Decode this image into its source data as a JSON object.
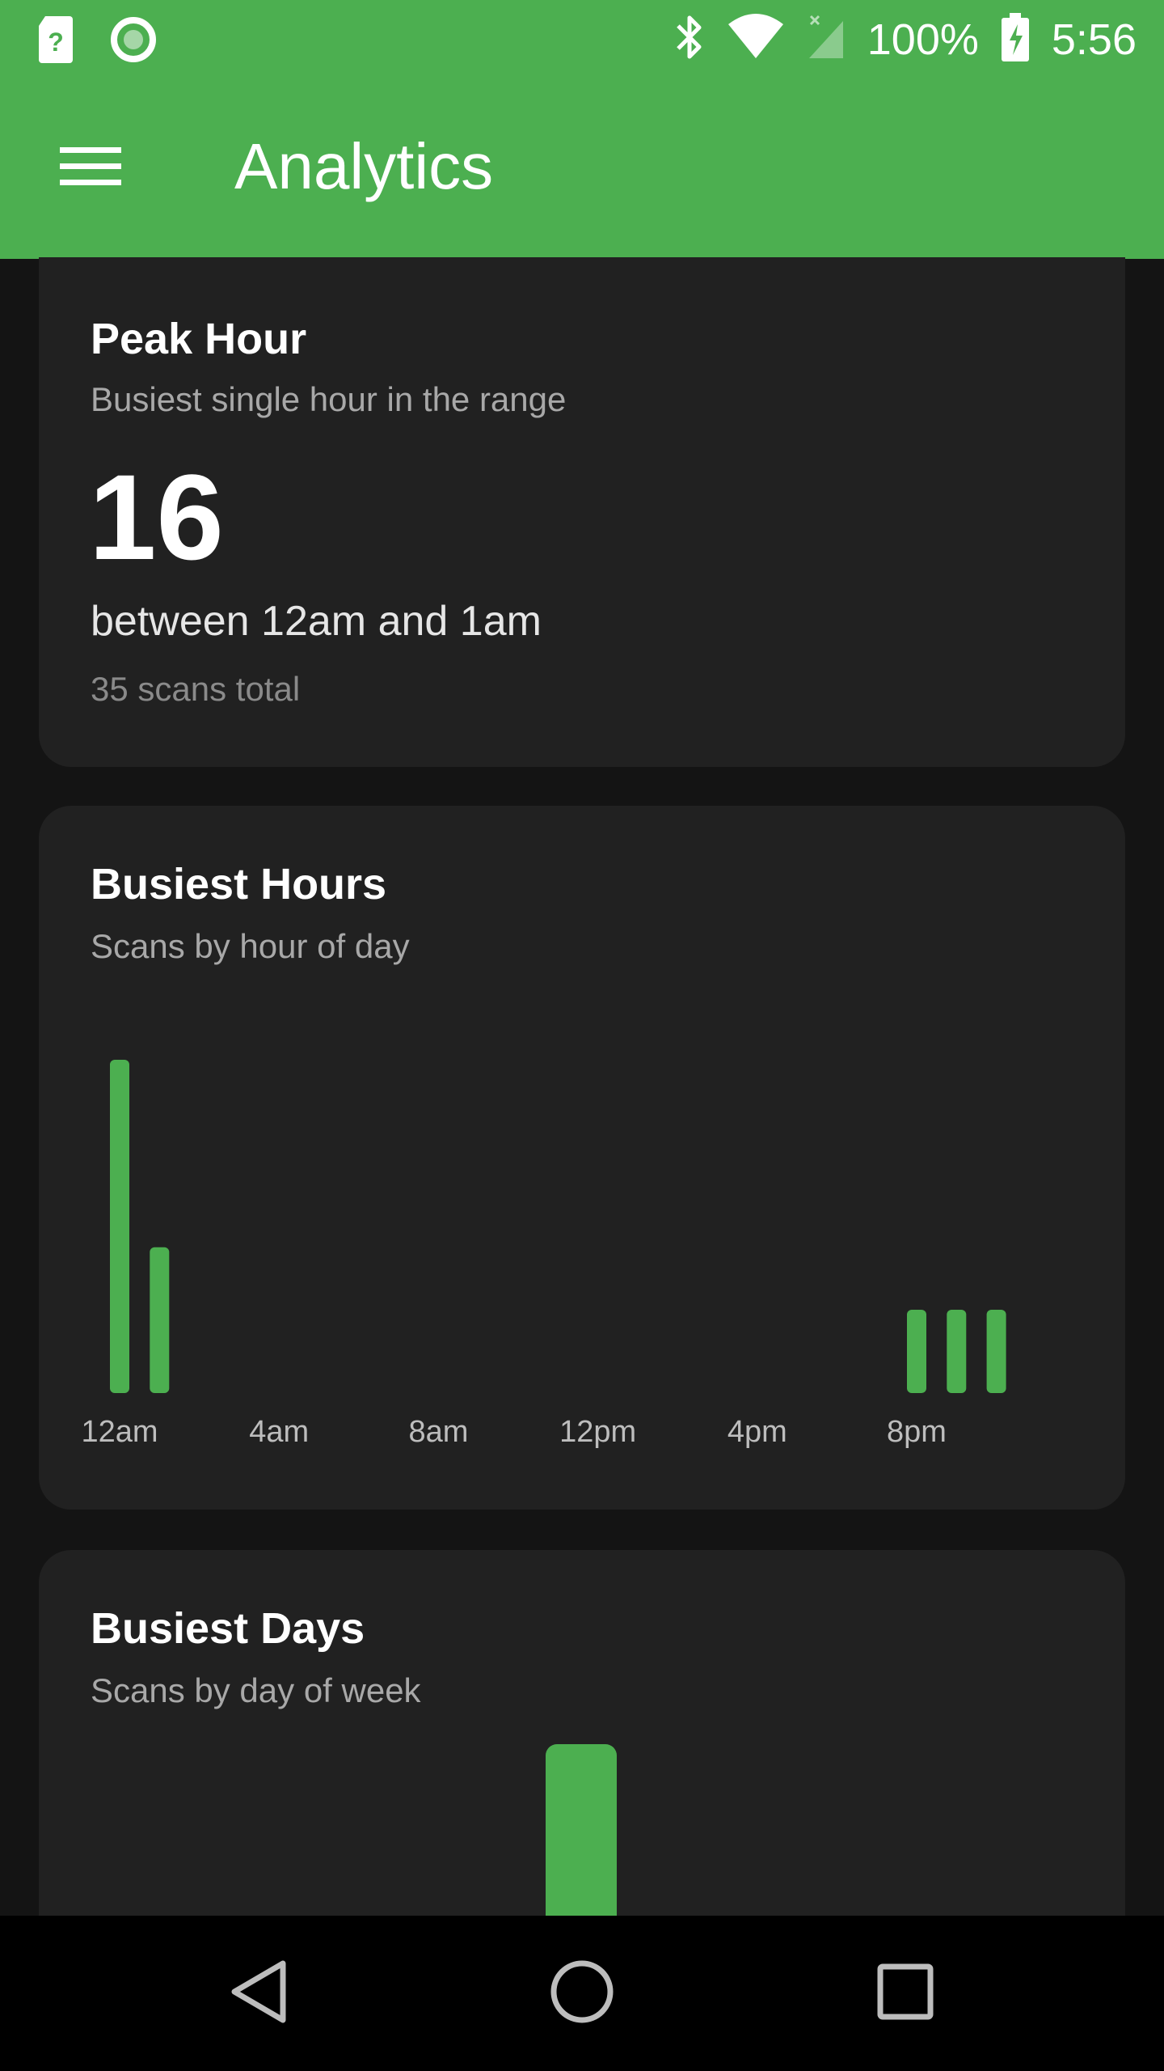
{
  "status_bar": {
    "battery_percent": "100%",
    "time": "5:56",
    "icons": [
      "sim-unknown-icon",
      "record-icon",
      "bluetooth-icon",
      "wifi-icon",
      "cell-signal-icon",
      "battery-charging-icon"
    ]
  },
  "app_bar": {
    "title": "Analytics",
    "menu_icon": "hamburger-menu-icon"
  },
  "peak_hour_card": {
    "title": "Peak Hour",
    "subtitle": "Busiest single hour in the range",
    "value": "16",
    "range_text": "between 12am and 1am",
    "total_text": "35 scans total"
  },
  "busiest_hours_card": {
    "title": "Busiest Hours",
    "subtitle": "Scans by hour of day"
  },
  "busiest_days_card": {
    "title": "Busiest Days",
    "subtitle": "Scans by day of week"
  },
  "colors": {
    "accent": "#4caf50",
    "background": "#141414",
    "card": "#212121"
  },
  "chart_data": [
    {
      "type": "bar",
      "title": "Busiest Hours",
      "subtitle": "Scans by hour of day",
      "categories": [
        "12am",
        "1am",
        "2am",
        "3am",
        "4am",
        "5am",
        "6am",
        "7am",
        "8am",
        "9am",
        "10am",
        "11am",
        "12pm",
        "1pm",
        "2pm",
        "3pm",
        "4pm",
        "5pm",
        "6pm",
        "7pm",
        "8pm",
        "9pm",
        "10pm",
        "11pm"
      ],
      "values": [
        16,
        7,
        0,
        0,
        0,
        0,
        0,
        0,
        0,
        0,
        0,
        0,
        0,
        0,
        0,
        0,
        0,
        0,
        0,
        0,
        4,
        4,
        4,
        0
      ],
      "tick_labels": [
        "12am",
        "4am",
        "8am",
        "12pm",
        "4pm",
        "8pm"
      ],
      "tick_indices": [
        0,
        4,
        8,
        12,
        16,
        20
      ],
      "ylim": [
        0,
        16
      ]
    },
    {
      "type": "bar",
      "title": "Busiest Days",
      "subtitle": "Scans by day of week",
      "categories": [
        "",
        "",
        "",
        "",
        "",
        "",
        ""
      ],
      "values": [
        0,
        0,
        0,
        1,
        0,
        0,
        0
      ],
      "partially_visible": true
    }
  ],
  "navigation": {
    "back_icon": "back-triangle-icon",
    "home_icon": "home-circle-icon",
    "recents_icon": "recents-square-icon"
  }
}
